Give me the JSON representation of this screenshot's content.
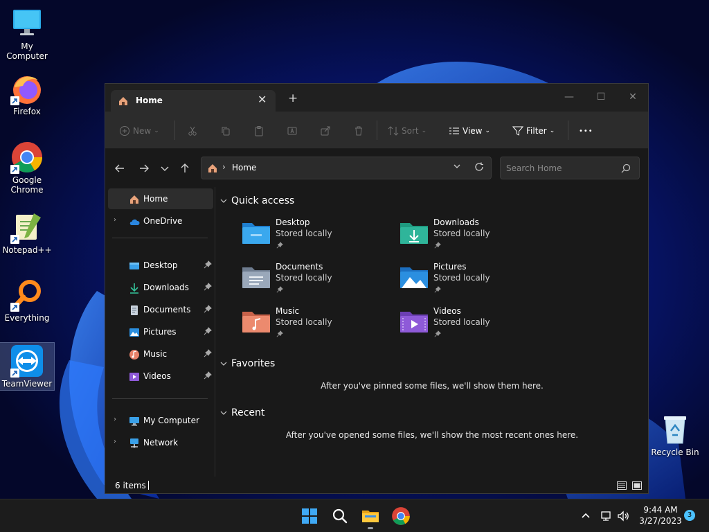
{
  "desktop": {
    "icons": [
      {
        "label": "My Computer",
        "icon": "monitor-icon"
      },
      {
        "label": "Firefox",
        "icon": "firefox-icon"
      },
      {
        "label": "Google\nChrome",
        "icon": "chrome-icon"
      },
      {
        "label": "Notepad++",
        "icon": "notepadpp-icon"
      },
      {
        "label": "Everything",
        "icon": "search-magnifier-icon"
      },
      {
        "label": "TeamViewer",
        "icon": "teamviewer-icon"
      },
      {
        "label": "Recycle Bin",
        "icon": "recycle-bin-icon"
      }
    ]
  },
  "window": {
    "tab_title": "Home",
    "tab_close": "✕",
    "new_tab": "+",
    "controls": {
      "minimize": "—",
      "maximize": "☐",
      "close": "✕"
    }
  },
  "toolbar": {
    "new_label": "New",
    "sort_label": "Sort",
    "view_label": "View",
    "filter_label": "Filter",
    "more_label": "•••"
  },
  "address": {
    "path": "Home",
    "search_placeholder": "Search Home"
  },
  "nav": {
    "items": [
      {
        "label": "Home",
        "icon": "home-icon"
      },
      {
        "label": "OneDrive",
        "icon": "cloud-icon"
      },
      {
        "label": "Desktop",
        "icon": "desktop-folder-icon"
      },
      {
        "label": "Downloads",
        "icon": "download-icon"
      },
      {
        "label": "Documents",
        "icon": "document-icon"
      },
      {
        "label": "Pictures",
        "icon": "pictures-icon"
      },
      {
        "label": "Music",
        "icon": "music-icon"
      },
      {
        "label": "Videos",
        "icon": "videos-icon"
      },
      {
        "label": "My Computer",
        "icon": "monitor-icon"
      },
      {
        "label": "Network",
        "icon": "network-icon"
      }
    ]
  },
  "content": {
    "quick_access": {
      "title": "Quick access",
      "items": [
        {
          "name": "Desktop",
          "sub": "Stored locally",
          "color": "#3aa0e8"
        },
        {
          "name": "Downloads",
          "sub": "Stored locally",
          "color": "#2fb59a"
        },
        {
          "name": "Documents",
          "sub": "Stored locally",
          "color": "#8d9cb0"
        },
        {
          "name": "Pictures",
          "sub": "Stored locally",
          "color": "#2b8fe0"
        },
        {
          "name": "Music",
          "sub": "Stored locally",
          "color": "#e8826a"
        },
        {
          "name": "Videos",
          "sub": "Stored locally",
          "color": "#8e5ad8"
        }
      ]
    },
    "favorites": {
      "title": "Favorites",
      "empty": "After you've pinned some files, we'll show them here."
    },
    "recent": {
      "title": "Recent",
      "empty": "After you've opened some files, we'll show the most recent ones here."
    }
  },
  "status": {
    "items_count": "6 items"
  },
  "taskbar": {
    "time": "9:44 AM",
    "date": "3/27/2023",
    "notification_count": "3"
  },
  "colors": {
    "accent": "#4cc2ff",
    "window_bg": "#191919",
    "toolbar_bg": "#2c2c2c"
  }
}
